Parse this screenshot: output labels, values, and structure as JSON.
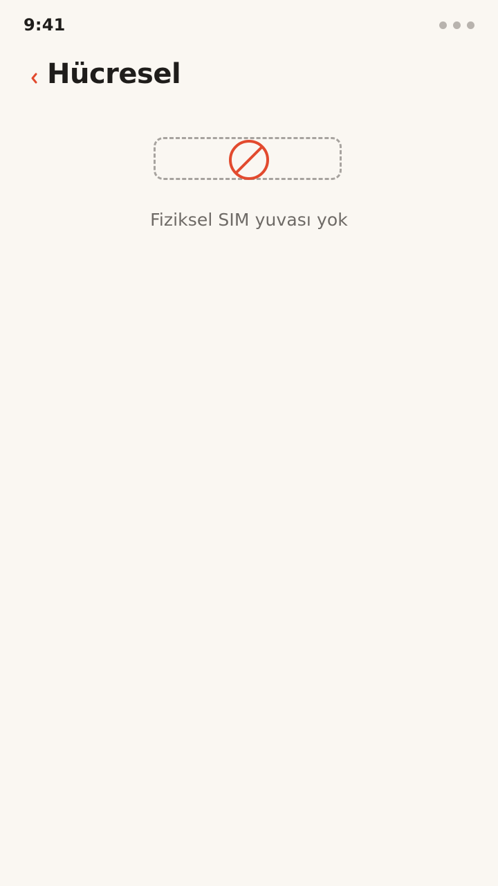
{
  "status_bar": {
    "time": "9:41",
    "menu_icon": "more-dots-icon"
  },
  "header": {
    "back_icon": "chevron-left-icon",
    "title": "Hücresel"
  },
  "content": {
    "slot_icon": "prohibited-icon",
    "message": "Fiziksel SIM yuvası yok"
  },
  "colors": {
    "background": "#faf7f2",
    "accent": "#e24a2e",
    "title": "#1f1d1b",
    "message": "#6e6a66",
    "slot_border": "#a7a39f"
  }
}
